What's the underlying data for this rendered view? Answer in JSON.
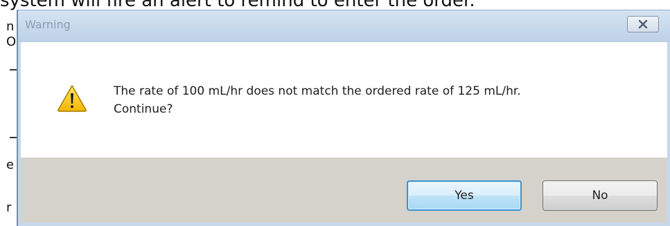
{
  "background": {
    "top_text": "system will fire an alert to remind to enter the order.",
    "side_fragments": [
      "n",
      "O",
      "e",
      "r"
    ]
  },
  "dialog": {
    "title": "Warning",
    "close_icon": "close-x-icon",
    "message_line1": "The rate of 100 mL/hr does not match the ordered rate of 125 mL/hr.",
    "message_line2": "Continue?",
    "icon": "warning-triangle-icon",
    "buttons": {
      "yes_label": "Yes",
      "no_label": "No"
    }
  },
  "colors": {
    "titlebar": "#c6d8ea",
    "footer": "#d5d1cb",
    "default_button_border": "#3c93cf",
    "warning_icon": "#f2c200"
  }
}
